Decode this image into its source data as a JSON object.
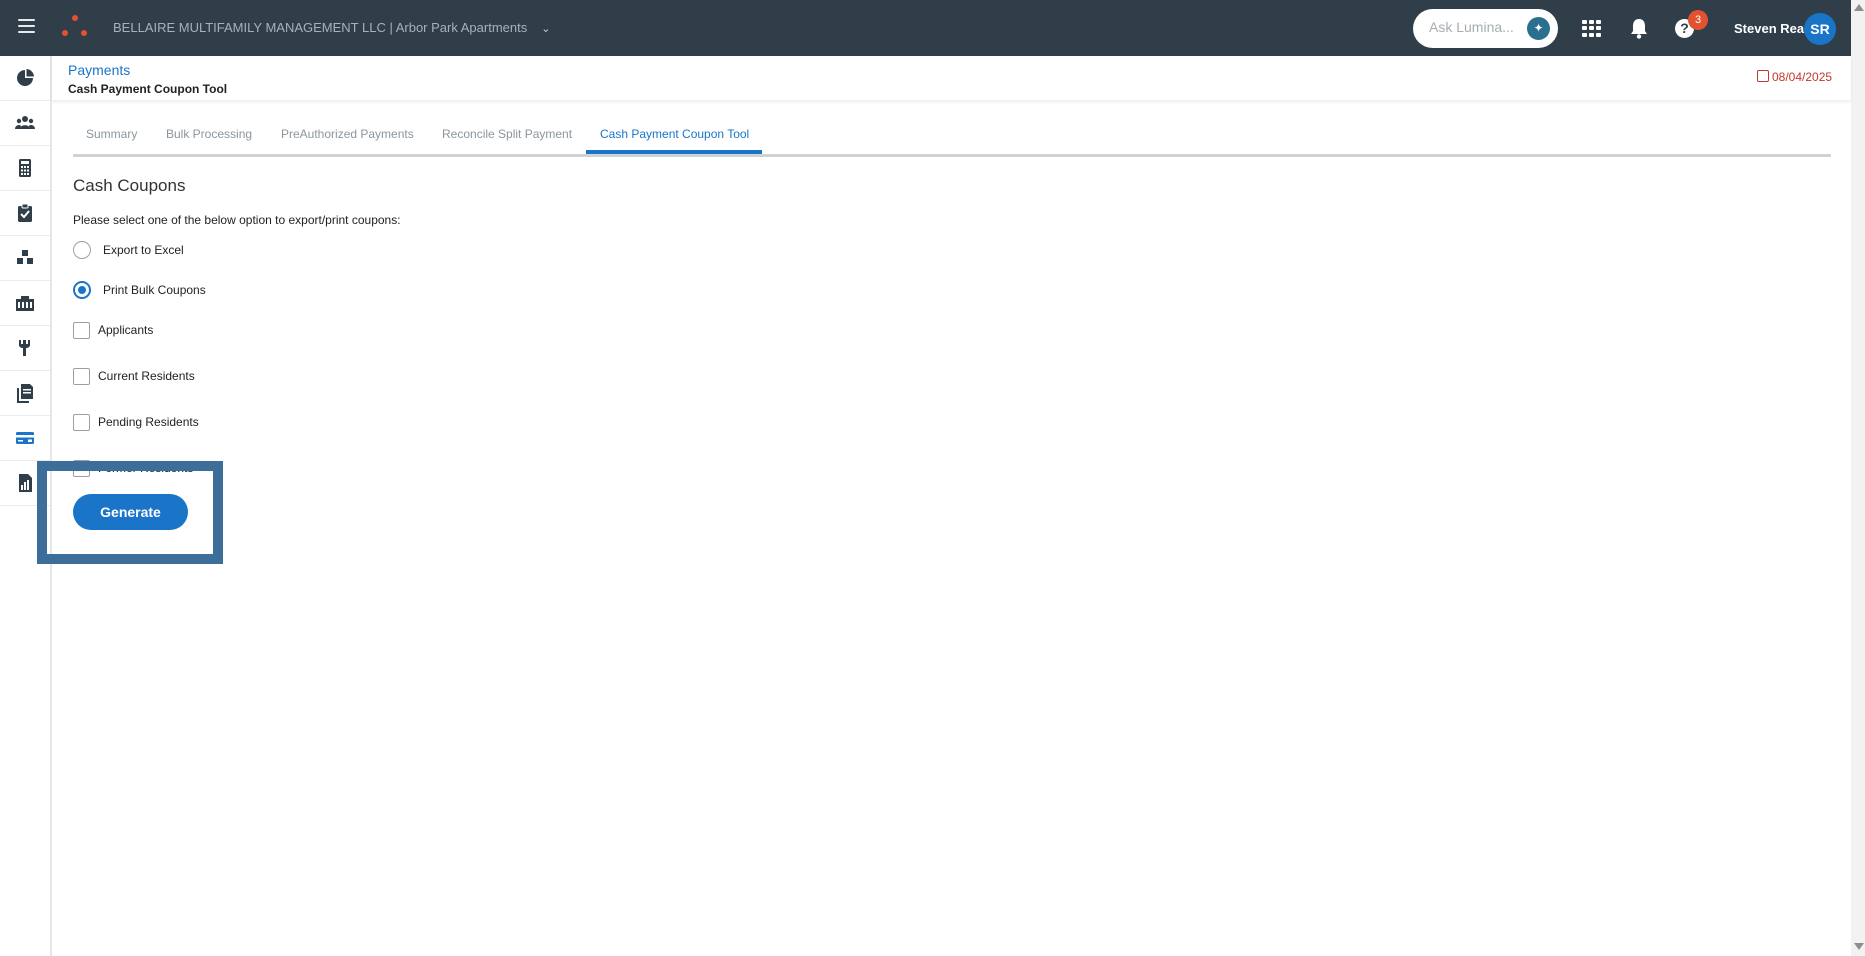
{
  "topbar": {
    "company": "BELLAIRE MULTIFAMILY MANAGEMENT LLC | Arbor Park Apartments",
    "ask_placeholder": "Ask Lumina...",
    "notification_count": "3",
    "user_name": "Steven Rea",
    "user_initials": "SR"
  },
  "sidebar": {
    "icons": [
      "dashboard-icon",
      "people-icon",
      "calculator-icon",
      "clipboard-check-icon",
      "boxes-icon",
      "building-icon",
      "tools-icon",
      "documents-icon",
      "payment-card-icon",
      "report-icon"
    ]
  },
  "breadcrumb": {
    "section": "Payments",
    "page": "Cash Payment Coupon Tool"
  },
  "date": "08/04/2025",
  "tabs": [
    {
      "label": "Summary"
    },
    {
      "label": "Bulk Processing"
    },
    {
      "label": "PreAuthorized Payments"
    },
    {
      "label": "Reconcile Split Payment"
    },
    {
      "label": "Cash Payment Coupon Tool",
      "active": true
    }
  ],
  "content": {
    "title": "Cash Coupons",
    "instruction": "Please select one of the below option to export/print coupons:",
    "radio_options": [
      {
        "label": "Export to Excel",
        "selected": false
      },
      {
        "label": "Print Bulk Coupons",
        "selected": true
      }
    ],
    "checkbox_options": [
      {
        "label": "Applicants",
        "checked": false
      },
      {
        "label": "Current Residents",
        "checked": false
      },
      {
        "label": "Pending Residents",
        "checked": false
      },
      {
        "label": "Former Residents",
        "checked": false
      }
    ],
    "generate_label": "Generate"
  },
  "colors": {
    "topbar": "#2f3e48",
    "accent": "#1a75c9",
    "logo": "#e2522f",
    "date": "#c0392b",
    "highlight": "#3c6e99"
  }
}
